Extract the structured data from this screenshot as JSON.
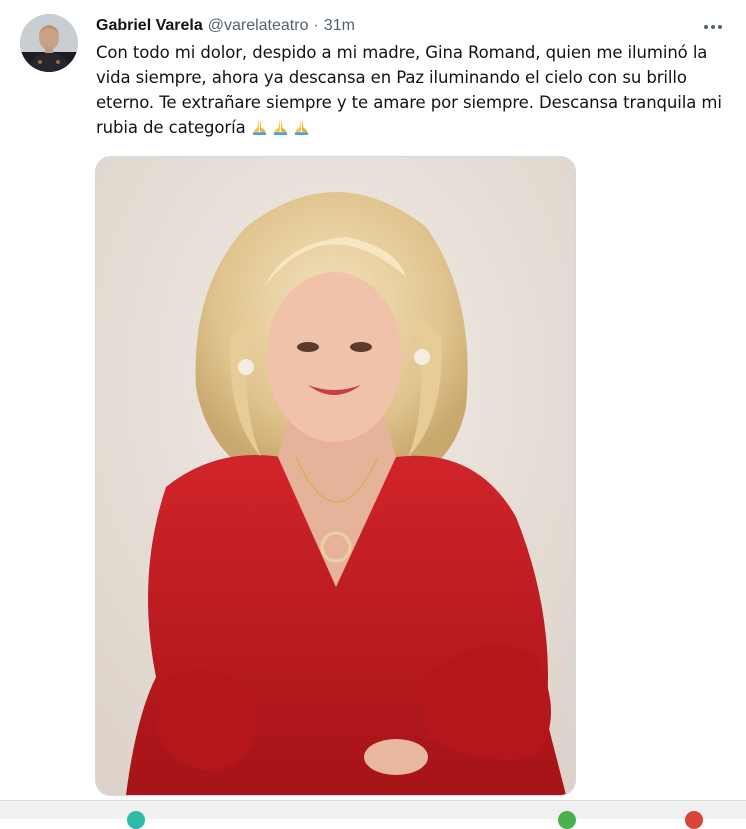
{
  "tweet": {
    "author_name": "Gabriel Varela",
    "handle": "@varelateatro",
    "separator": "·",
    "time": "31m",
    "text": "Con todo mi dolor, despido a mi madre, Gina Romand, quien me iluminó la vida siempre, ahora ya descansa en Paz iluminando el cielo con su brillo eterno. Te extrañare siempre y te amare por siempre. Descansa tranquila mi rubia de categoría",
    "emojis": [
      "folded-hands-icon",
      "folded-hands-icon",
      "folded-hands-icon"
    ],
    "more_icon": "more-horizontal-icon",
    "media": "photo-woman-red-dress"
  },
  "colors": {
    "text": "#0f1419",
    "secondary": "#536471",
    "border": "#cfd9de",
    "dress": "#c0181c",
    "photo_background": "#e9e1da"
  }
}
